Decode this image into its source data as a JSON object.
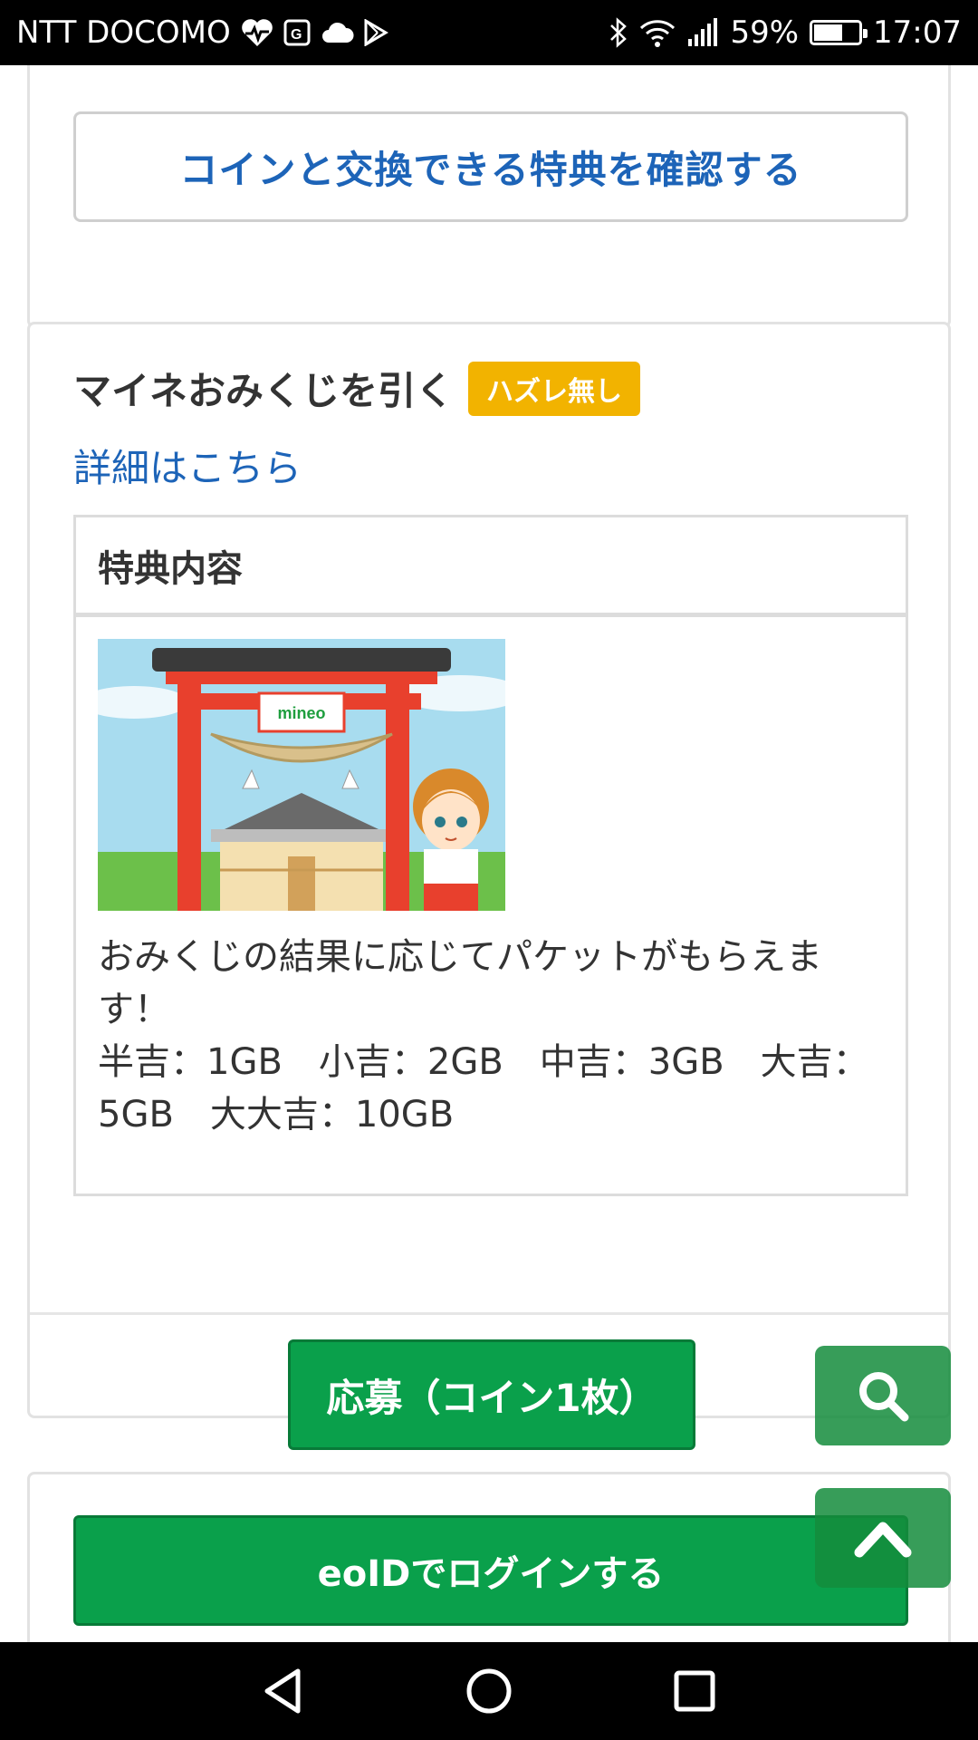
{
  "status_bar": {
    "carrier": "NTT DOCOMO",
    "battery": "59%",
    "battery_level": 0.59,
    "time": "17:07",
    "icons": [
      "health-icon",
      "map-icon",
      "cloud-icon",
      "play-store-icon",
      "bluetooth-icon",
      "wifi-icon",
      "signal-icon",
      "battery-icon"
    ]
  },
  "coin_section": {
    "check_benefits_button": "コインと交換できる特典を確認する"
  },
  "omikuji": {
    "title": "マイネおみくじを引く",
    "badge": "ハズレ無し",
    "detail_link": "詳細はこちら",
    "benefit_header": "特典内容",
    "image_alt": "mineo",
    "description_line1": "おみくじの結果に応じてパケットがもらえます！",
    "description_line2": "半吉：1GB　小吉：2GB　中吉：3GB　大吉：5GB　大大吉：10GB",
    "apply_button": "応募（コイン1枚）"
  },
  "login": {
    "button": "eoIDでログインする"
  },
  "floating": {
    "search_icon": "search-icon",
    "top_icon": "chevron-up-icon"
  },
  "nav_bar": {
    "icons": [
      "back-icon",
      "home-icon",
      "recents-icon"
    ]
  },
  "colors": {
    "link_blue": "#1d64b8",
    "badge_yellow": "#f2b300",
    "button_green": "#0aa04b"
  }
}
